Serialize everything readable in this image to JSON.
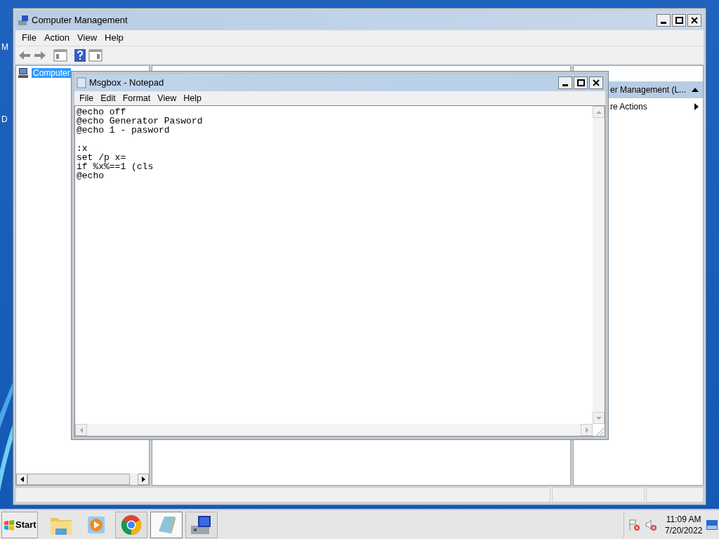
{
  "desktop": {
    "icon_labels": [
      "M",
      "D"
    ]
  },
  "computer_management": {
    "title": "Computer Management",
    "menu": [
      "File",
      "Action",
      "View",
      "Help"
    ],
    "tree": [
      {
        "label": "Computer",
        "selected": true
      }
    ],
    "actions": [
      {
        "label": "er Management (L...",
        "kind": "header"
      },
      {
        "label": "re Actions",
        "kind": "submenu"
      }
    ]
  },
  "notepad": {
    "title": "Msgbox - Notepad",
    "menu": [
      "File",
      "Edit",
      "Format",
      "View",
      "Help"
    ],
    "text": "@echo off\n@echo Generator Pasword\n@echo 1 - pasword\n\n:x\nset /p x=\nif %x%==1 (cls\n@echo"
  },
  "taskbar": {
    "start": "Start",
    "apps": [
      {
        "kind": "explorer",
        "running": false,
        "selected": false
      },
      {
        "kind": "media",
        "running": false,
        "selected": false
      },
      {
        "kind": "chrome",
        "running": true,
        "selected": false
      },
      {
        "kind": "notepad",
        "running": true,
        "selected": true
      },
      {
        "kind": "compmgmt",
        "running": true,
        "selected": false
      }
    ],
    "time": "11:09 AM",
    "date": "7/20/2022"
  }
}
